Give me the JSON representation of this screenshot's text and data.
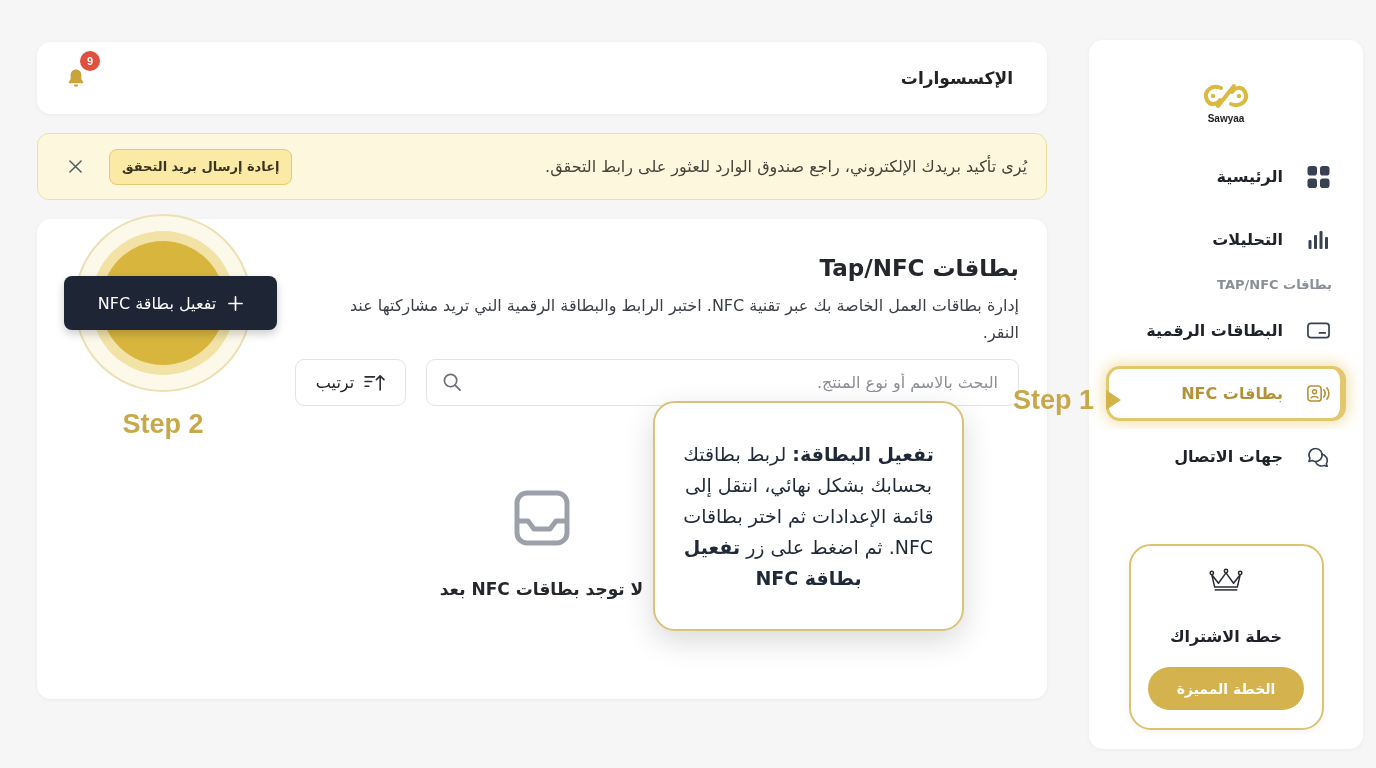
{
  "sidebar": {
    "logo_text": "Sawyaa",
    "nav": [
      {
        "kind": "link",
        "label": "الرئيسية",
        "selected": false
      },
      {
        "kind": "link",
        "label": "التحليلات",
        "selected": false
      },
      {
        "kind": "section",
        "label": "بطاقات TAP/NFC"
      },
      {
        "kind": "link",
        "label": "البطاقات الرقمية",
        "selected": false
      },
      {
        "kind": "link",
        "label": "بطاقات NFC",
        "selected": true
      },
      {
        "kind": "link",
        "label": "جهات الاتصال",
        "selected": false
      }
    ],
    "plan": {
      "title": "خطة الاشتراك",
      "action": "الخطة المميزة"
    }
  },
  "header": {
    "title": "الإكسسوارات",
    "notification_count": "9"
  },
  "banner": {
    "message": "يُرى تأكيد بريدك الإلكتروني، راجع صندوق الوارد للعثور على رابط التحقق.",
    "action": "إعادة إرسال بريد التحقق"
  },
  "content": {
    "title": "بطاقات Tap/NFC",
    "description": "إدارة بطاقات العمل الخاصة بك عبر تقنية NFC. اختبر الرابط والبطاقة الرقمية الني تريد مشاركتها عند النقر.",
    "primary_action": "تفعيل بطاقة NFC",
    "search": {
      "placeholder": "البحث بالاسم أو نوع المنتج."
    },
    "sort": "ترتيب",
    "empty_state": "لا توجد بطاقات NFC بعد"
  },
  "tour": {
    "steps": [
      {
        "label": "Step 1"
      },
      {
        "label": "Step 2"
      }
    ],
    "tooltip": "**تفعيل البطاقة:** لربط بطاقتك بحسابك بشكل نهائي، انتقل إلى قائمة الإعدادات ثم اختر بطاقات NFC. ثم اضغط على زر **تفعيل بطاقة NFC**"
  }
}
